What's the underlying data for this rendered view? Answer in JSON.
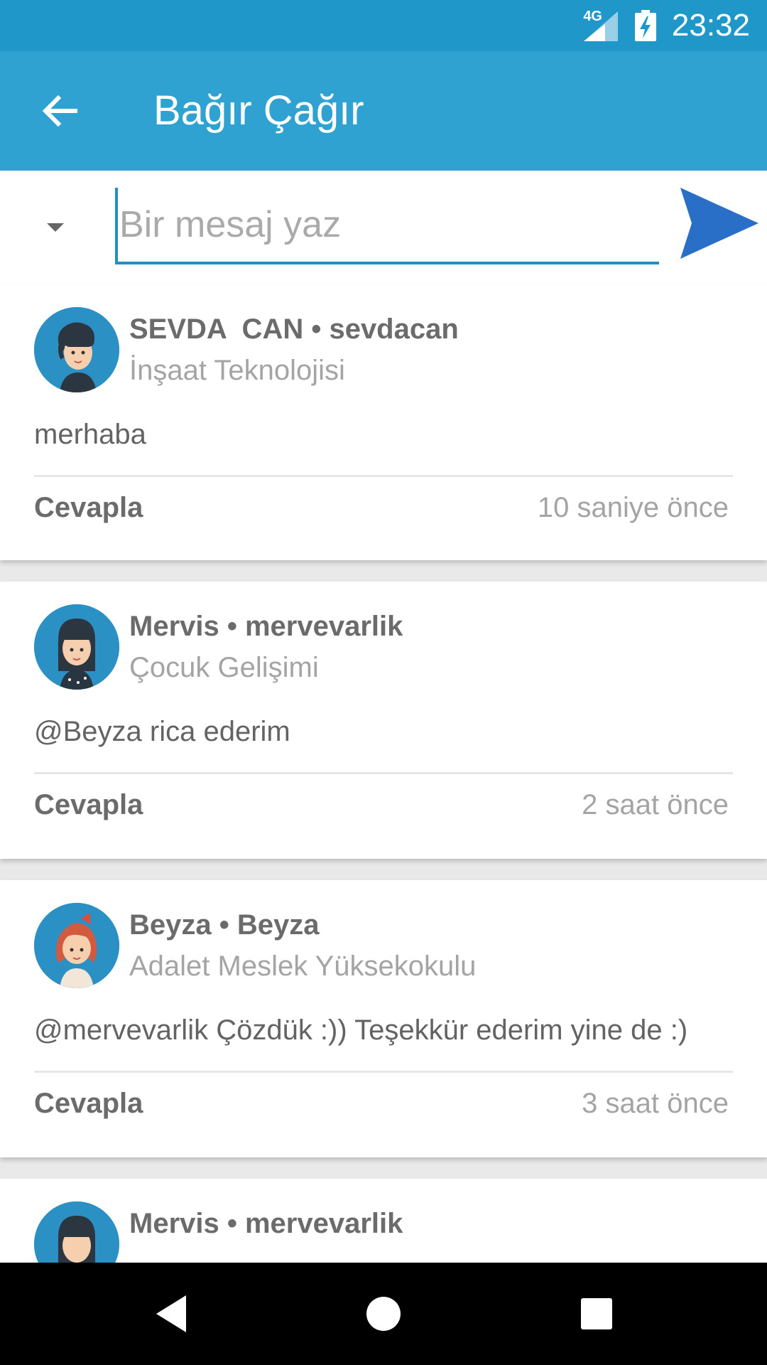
{
  "status_bar": {
    "time": "23:32",
    "network": "4G"
  },
  "app_bar": {
    "title": "Bağır Çağır",
    "back_icon": "arrow-left-icon"
  },
  "composer": {
    "placeholder": "Bir mesaj yaz",
    "value": ""
  },
  "colors": {
    "status_bar": "#1f97c9",
    "app_bar": "#2fa2d2",
    "send": "#2a6fc7",
    "avatar_bg": "#2b90c3"
  },
  "posts": [
    {
      "name": "SEVDA  CAN • sevdacan",
      "department": "İnşaat Teknolojisi",
      "message": "merhaba",
      "reply_label": "Cevapla",
      "time": "10 saniye önce"
    },
    {
      "name": "Mervis • mervevarlik",
      "department": "Çocuk Gelişimi",
      "message": "@Beyza rica ederim",
      "reply_label": "Cevapla",
      "time": "2 saat önce"
    },
    {
      "name": "Beyza • Beyza",
      "department": "Adalet Meslek Yüksekokulu",
      "message": "@mervevarlik Çözdük :)) Teşekkür ederim yine de :)",
      "reply_label": "Cevapla",
      "time": "3 saat önce"
    },
    {
      "name": "Mervis • mervevarlik"
    }
  ]
}
